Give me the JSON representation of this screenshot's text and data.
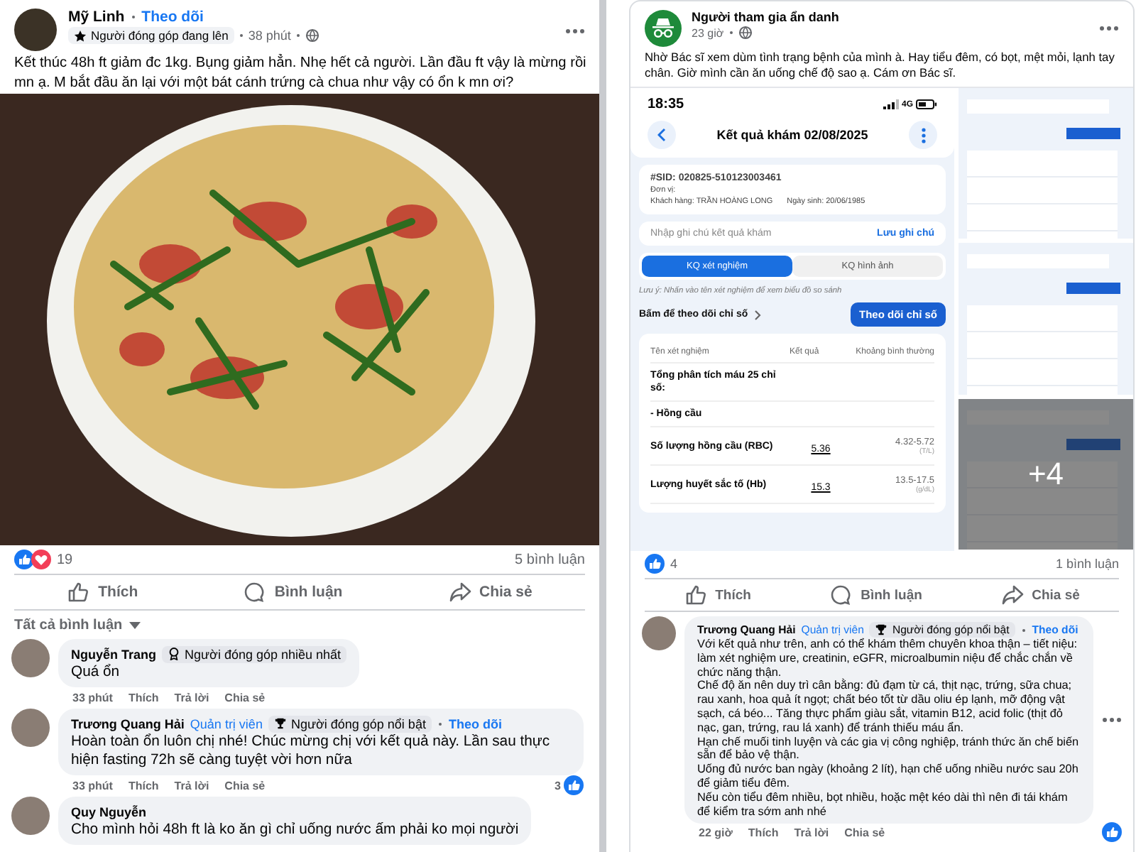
{
  "left_post": {
    "author": "Mỹ Linh",
    "follow": "Theo dõi",
    "badge": {
      "label": "Người đóng góp đang lên",
      "kind": "star"
    },
    "time": "38 phút",
    "text": "Kết thúc 48h ft giảm đc 1kg. Bụng giảm hẳn. Nhẹ hết cả người. Lần đầu ft vậy là mừng rồi mn ạ. M bắt đầu ăn lại với một bát cánh trứng cà chua như vậy có ổn k mn ơi?",
    "reaction_count": "19",
    "comment_count": "5 bình luận",
    "actions": [
      {
        "label": "Thích",
        "kind": "like"
      },
      {
        "label": "Bình luận",
        "kind": "comment"
      },
      {
        "label": "Chia sẻ",
        "kind": "share"
      }
    ],
    "comment_filter": "Tất cả bình luận",
    "comments": [
      {
        "author": "Nguyễn Trang",
        "badge": {
          "label": "Người đóng góp nhiều nhất",
          "kind": "medal"
        },
        "paragraphs": [
          "Quá ổn"
        ],
        "time": "33 phút",
        "actions": [
          "Thích",
          "Trả lời",
          "Chia sẻ"
        ]
      },
      {
        "author": "Trương Quang Hải",
        "role": "Quản trị viên",
        "badge": {
          "label": "Người đóng góp nổi bật",
          "kind": "trophy"
        },
        "follow": "Theo dõi",
        "paragraphs": [
          "Hoàn toàn ổn luôn chị nhé! Chúc mừng chị với kết quả này. Lần sau thực hiện fasting 72h sẽ càng tuyệt vời hơn nữa"
        ],
        "time": "33 phút",
        "actions": [
          "Thích",
          "Trả lời",
          "Chia sẻ"
        ],
        "likes": "3",
        "reacted": true
      },
      {
        "author": "Quy Nguyễn",
        "paragraphs": [
          "Cho mình hỏi 48h ft là ko ăn gì chỉ uống nước ấm phải ko mọi người"
        ]
      }
    ]
  },
  "right_post": {
    "author": "Người tham gia ẩn danh",
    "time": "23 giờ",
    "text": "Nhờ Bác sĩ xem dùm tình trạng bệnh của mình à. Hay tiểu đêm, có bọt, mệt mỏi, lạnh tay chân. Giờ mình cần ăn uống chế độ sao ạ. Cám ơn Bác sĩ.",
    "screenshot": {
      "clock": "18:35",
      "network": "4G",
      "title": "Kết quả khám 02/08/2025",
      "sid": "#SID: 020825-510123003461",
      "unit": "Đơn vị:",
      "customer": "Khách hàng: TRẦN HOÀNG LONG",
      "birth": "Ngày sinh: 20/06/1985",
      "note_placeholder": "Nhập ghi chú kết quả khám",
      "save_note": "Lưu ghi chú",
      "tabs": [
        {
          "label": "KQ xét nghiệm",
          "selected": true
        },
        {
          "label": "KQ hình ảnh",
          "selected": false
        }
      ],
      "hint": "Lưu ý: Nhấn vào tên xét nghiệm để xem biểu đồ so sánh",
      "track_link": "Bấm để theo dõi chỉ số",
      "track_button": "Theo dõi chỉ số",
      "columns": [
        "Tên xét nghiệm",
        "Kết quả",
        "Khoảng bình thường"
      ],
      "rows": [
        {
          "name": "Tổng phân tích máu 25 chỉ số:"
        },
        {
          "name": "- Hồng cầu"
        },
        {
          "name": "Số lượng hồng cầu (RBC)",
          "result": "5.36",
          "range": "4.32-5.72",
          "unit": "(T/L)"
        },
        {
          "name": "Lượng huyết sắc tố (Hb)",
          "result": "15.3",
          "range": "13.5-17.5",
          "unit": "(g/dL)"
        }
      ]
    },
    "more_photos": "+4",
    "reaction_count": "4",
    "comment_count": "1 bình luận",
    "actions": [
      {
        "label": "Thích",
        "kind": "like"
      },
      {
        "label": "Bình luận",
        "kind": "comment"
      },
      {
        "label": "Chia sẻ",
        "kind": "share"
      }
    ],
    "comments": [
      {
        "author": "Trương Quang Hải",
        "role": "Quản trị viên",
        "badge": {
          "label": "Người đóng góp nổi bật",
          "kind": "trophy"
        },
        "follow": "Theo dõi",
        "paragraphs": [
          "Với kết quả như trên, anh có thể khám thêm chuyên khoa thận – tiết niệu: làm xét nghiệm ure, creatinin, eGFR, microalbumin niệu để chắc chắn về chức năng thận.",
          "Chế độ ăn nên duy trì cân bằng: đủ đạm từ cá, thịt nạc, trứng, sữa chua; rau xanh, hoa quả ít ngọt; chất béo tốt từ dầu oliu ép lạnh, mỡ động vật sạch, cá béo... Tăng thực phẩm giàu sắt, vitamin B12, acid folic (thịt đỏ nạc, gan, trứng, rau lá xanh) để tránh thiếu máu ẩn.",
          "Hạn chế muối tinh luyện và các gia vị công nghiệp, tránh thức ăn chế biến sẵn để bảo vệ thận.",
          "Uống đủ nước ban ngày (khoảng 2 lít), hạn chế uống nhiều nước sau 20h để giảm tiểu đêm.",
          "Nếu còn tiểu đêm nhiều, bọt nhiều, hoặc mệt kéo dài thì nên đi tái khám để kiểm tra sớm anh nhé"
        ],
        "time": "22 giờ",
        "actions": [
          "Thích",
          "Trả lời",
          "Chia sẻ"
        ],
        "reacted": true,
        "more": true
      }
    ]
  }
}
